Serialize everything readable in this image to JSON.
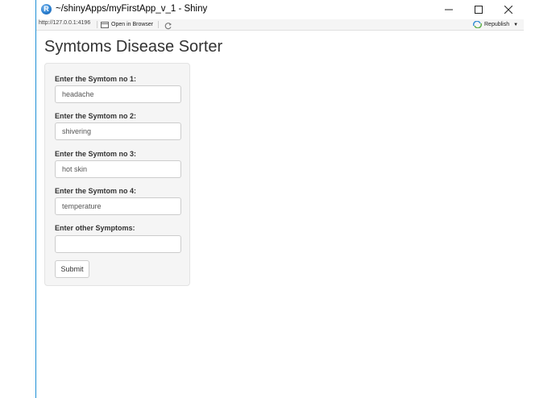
{
  "window": {
    "title": "~/shinyApps/myFirstApp_v_1 - Shiny",
    "app_icon": "rstudio-icon"
  },
  "toolbar": {
    "url": "http://127.0.0.1:4196",
    "open_in_browser_label": "Open in Browser",
    "republish_label": "Republish"
  },
  "page": {
    "title": "Symtoms Disease Sorter"
  },
  "form": {
    "fields": [
      {
        "label": "Enter the Symtom no 1:",
        "value": "headache"
      },
      {
        "label": "Enter the Symtom no 2:",
        "value": "shivering"
      },
      {
        "label": "Enter the Symtom no 3:",
        "value": "hot skin"
      },
      {
        "label": "Enter the Symtom no 4:",
        "value": "temperature"
      },
      {
        "label": "Enter other Symptoms:",
        "value": ""
      }
    ],
    "submit_label": "Submit"
  },
  "colors": {
    "window_accent": "#1e90d6",
    "panel_background": "#f5f5f5"
  }
}
